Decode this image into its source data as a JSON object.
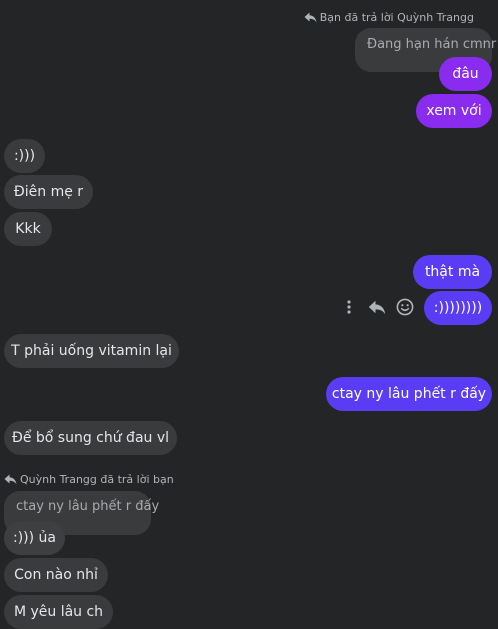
{
  "colors": {
    "background": "#242526",
    "incoming_bubble": "#3a3b3c",
    "outgoing_violet": "#8a2bf0",
    "outgoing_blue": "#5b3cf5"
  },
  "reply_1": {
    "header": "Bạn đã trả lời Quỳnh Trangg",
    "quoted": "Đang hạn hán cmnr",
    "icon": "reply-arrow-icon"
  },
  "messages": {
    "m1": "đâu",
    "m2": "xem với",
    "m3": ":)))",
    "m4": "Điên mẹ r",
    "m5": "Kkk",
    "m6": "thật mà",
    "m7": ":))))))))",
    "m8": "T phải uống vitamin lại",
    "m9": "ctay ny lâu phết r đấy",
    "m10": "Để bổ sung chứ đau vl",
    "m11": ":))) ủa",
    "m12": "Con nào nhỉ",
    "m13": "M yêu lâu ch"
  },
  "message_actions": {
    "icons": [
      "more-options-icon",
      "reply-icon",
      "react-emoji-icon"
    ]
  },
  "reply_2": {
    "header": "Quỳnh Trangg đã trả lời bạn",
    "quoted": "ctay ny lâu phết r đấy",
    "icon": "reply-arrow-icon"
  }
}
